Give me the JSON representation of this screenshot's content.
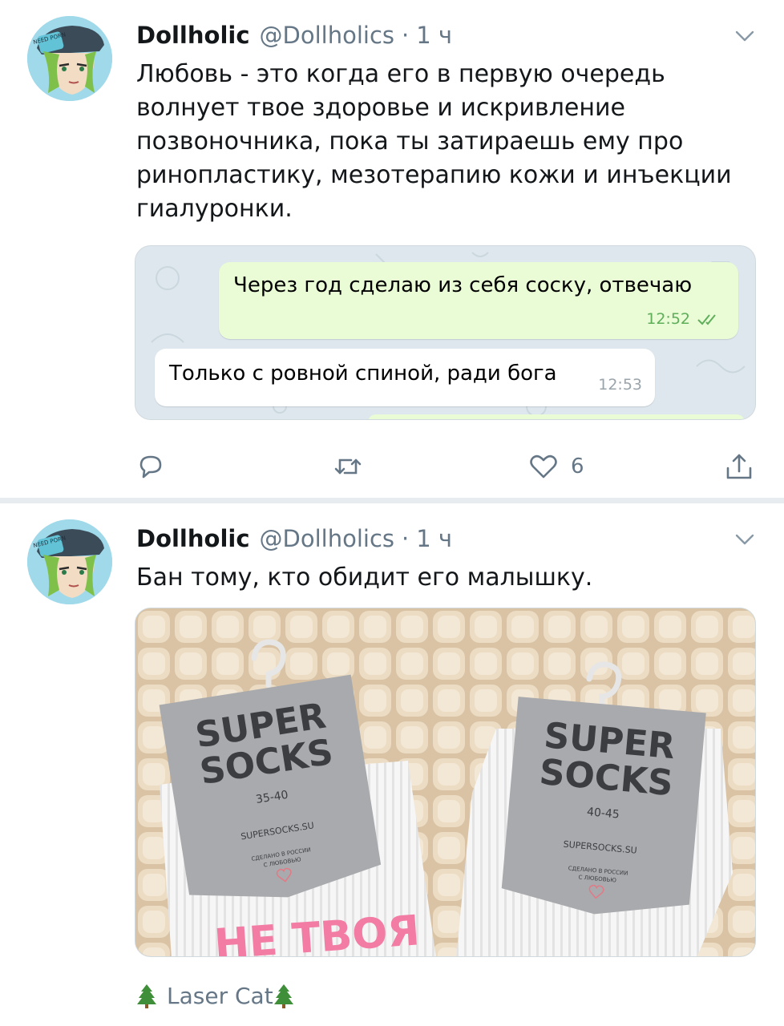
{
  "tweets": [
    {
      "author_name": "Dollholic",
      "handle": "@Dollholics",
      "separator": "·",
      "time": "1 ч",
      "text": "Любовь - это когда его в первую очередь волнует твое здоровье и искривление позвоночника, пока ты затираешь ему про ринопластику, мезотерапию кожи и инъекции гиалуронки.",
      "media_chat": {
        "outgoing_message": "Через год сделаю из себя соску, отвечаю",
        "outgoing_time": "12:52",
        "incoming_message": "Только с ровной спиной, ради бога",
        "incoming_time": "12:53"
      },
      "actions": {
        "like_count": "6"
      },
      "avatar_text": "NEED PORN"
    },
    {
      "author_name": "Dollholic",
      "handle": "@Dollholics",
      "separator": "·",
      "time": "1 ч",
      "text": "Бан тому, кто обидит его малышку.",
      "media_photo": {
        "left_tag": {
          "brand_line1": "SUPER",
          "brand_line2": "SOCKS",
          "size": "35-40",
          "site": "SUPERSOCKS.SU",
          "note1": "СДЕЛАНО В РОССИИ",
          "note2": "С ЛЮБОВЬЮ"
        },
        "right_tag": {
          "brand_line1": "SUPER",
          "brand_line2": "SOCKS",
          "size": "40-45",
          "site": "SUPERSOCKS.SU",
          "note1": "СДЕЛАНО В РОССИИ",
          "note2": "С ЛЮБОВЬЮ"
        },
        "sock_print": "НЕ ТВОЯ"
      },
      "avatar_text": "NEED PORN"
    }
  ],
  "footer": {
    "label": "Laser Cat"
  },
  "colors": {
    "text": "#14171a",
    "muted": "#657786",
    "divider": "#e6ecf0",
    "chat_outgoing": "#e9fcd6",
    "chat_bg": "#dfe8ee",
    "tree_green": "#3f8f3a",
    "sock_pink": "#f27ca4"
  },
  "icons": [
    "chevron-down-icon",
    "reply-icon",
    "retweet-icon",
    "heart-icon",
    "share-icon",
    "read-ticks-icon",
    "tree-icon"
  ]
}
